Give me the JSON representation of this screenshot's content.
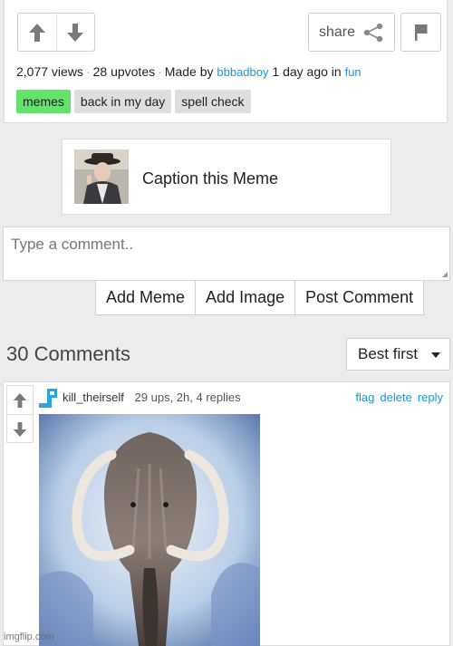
{
  "post": {
    "share_label": "share",
    "views": "2,077 views",
    "upvotes": "28 upvotes",
    "made_by_prefix": "Made by",
    "author": "bbbadboy",
    "time_text": "1 day ago in",
    "stream": "fun",
    "tags": [
      {
        "label": "memes",
        "color": "#62e36b"
      },
      {
        "label": "back in my day",
        "color": "#dedede"
      },
      {
        "label": "spell check",
        "color": "#dedede"
      }
    ]
  },
  "caption_meme": {
    "label": "Caption this Meme"
  },
  "comment_box": {
    "placeholder": "Type a comment.."
  },
  "actions": {
    "add_meme": "Add Meme",
    "add_image": "Add Image",
    "post_comment": "Post Comment"
  },
  "comments_header": {
    "count": "30 Comments",
    "sort_label": "Best first"
  },
  "comment": {
    "username": "kill_theirself",
    "stats": "29 ups, 2h, 4 replies",
    "links": [
      "flag",
      "delete",
      "reply"
    ],
    "image_subject": "woolly mammoth"
  },
  "watermark": "imgflip.com",
  "colors": {
    "link": "#1a9ad6",
    "tag_green": "#62e36b",
    "background": "#ececec"
  }
}
